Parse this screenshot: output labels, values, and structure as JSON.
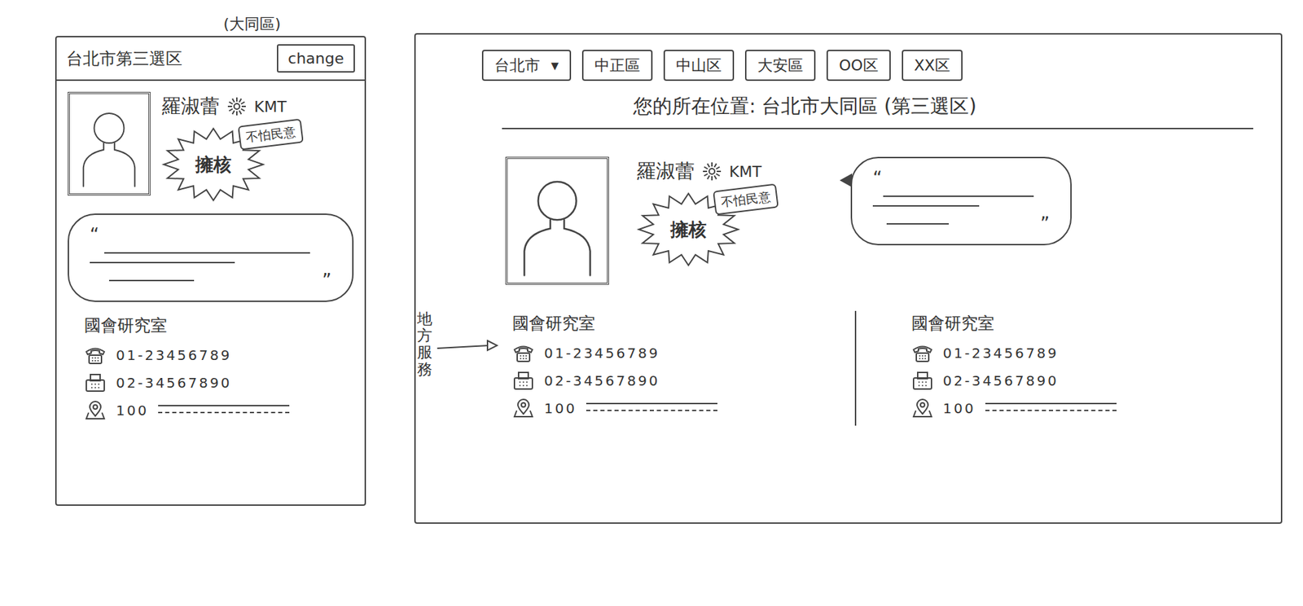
{
  "mobile": {
    "caption": "(大同區)",
    "district": "台北市第三選区",
    "change_button": "change",
    "legislator": {
      "name": "羅淑蕾",
      "party": "KMT",
      "stance": "擁核",
      "tag": "不怕民意",
      "quote_open": "“",
      "quote_close": "”"
    },
    "office": {
      "title": "國會研究室",
      "phone": "01-23456789",
      "fax": "02-34567890",
      "address": "100"
    }
  },
  "desktop": {
    "city": {
      "label": "台北市",
      "caret": "▾"
    },
    "tabs": [
      {
        "label": "中正區",
        "selected": false
      },
      {
        "label": "中山区",
        "selected": false
      },
      {
        "label": "大安區",
        "selected": false
      },
      {
        "label": "OO区",
        "selected": false
      },
      {
        "label": "XX区",
        "selected": false
      }
    ],
    "location": "您的所在位置: 台北市大同區 (第三選区)",
    "legislator": {
      "name": "羅淑蕾",
      "party": "KMT",
      "stance": "擁核",
      "tag": "不怕民意",
      "quote_open": "“",
      "quote_close": "”"
    },
    "annotation": "地方服務",
    "offices": [
      {
        "title": "國會研究室",
        "phone": "01-23456789",
        "fax": "02-34567890",
        "address": "100"
      },
      {
        "title": "國會研究室",
        "phone": "01-23456789",
        "fax": "02-34567890",
        "address": "100"
      }
    ]
  }
}
